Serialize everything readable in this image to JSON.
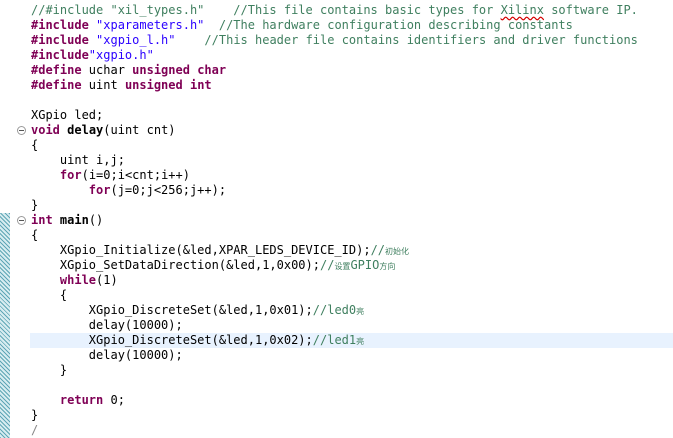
{
  "editor": {
    "lines": [
      [
        {
          "t": "//#include \"xil_types.h\"    //This file contains basic types for ",
          "c": "cm"
        },
        {
          "t": "Xilinx",
          "c": "cm sq"
        },
        {
          "t": " software IP.",
          "c": "cm"
        }
      ],
      [
        {
          "t": "#include",
          "c": "kw"
        },
        {
          "t": " "
        },
        {
          "t": "\"xparameters.h\"",
          "c": "str"
        },
        {
          "t": "  "
        },
        {
          "t": "//The hardware configuration describing constants",
          "c": "cm"
        }
      ],
      [
        {
          "t": "#include",
          "c": "kw"
        },
        {
          "t": " "
        },
        {
          "t": "\"xgpio_l.h\"",
          "c": "str"
        },
        {
          "t": "    "
        },
        {
          "t": "//This header file contains identifiers and driver functions",
          "c": "cm"
        }
      ],
      [
        {
          "t": "#include",
          "c": "kw"
        },
        {
          "t": "\"xgpio.h\"",
          "c": "str"
        }
      ],
      [
        {
          "t": "#define",
          "c": "kw"
        },
        {
          "t": " uchar "
        },
        {
          "t": "unsigned",
          "c": "kw"
        },
        {
          "t": " "
        },
        {
          "t": "char",
          "c": "kw"
        }
      ],
      [
        {
          "t": "#define",
          "c": "kw"
        },
        {
          "t": " uint "
        },
        {
          "t": "unsigned",
          "c": "kw"
        },
        {
          "t": " "
        },
        {
          "t": "int",
          "c": "kw"
        }
      ],
      [],
      [
        {
          "t": "XGpio led;"
        }
      ],
      [
        {
          "t": "void",
          "c": "kw"
        },
        {
          "t": " "
        },
        {
          "t": "delay",
          "c": "bd"
        },
        {
          "t": "(uint cnt)"
        }
      ],
      [
        {
          "t": "{"
        }
      ],
      [
        {
          "t": "    uint i,j;"
        }
      ],
      [
        {
          "t": "    "
        },
        {
          "t": "for",
          "c": "kw"
        },
        {
          "t": "(i=0;i<cnt;i++)"
        }
      ],
      [
        {
          "t": "        "
        },
        {
          "t": "for",
          "c": "kw"
        },
        {
          "t": "(j=0;j<256;j++);"
        }
      ],
      [
        {
          "t": "}"
        }
      ],
      [
        {
          "t": "int",
          "c": "kw"
        },
        {
          "t": " "
        },
        {
          "t": "main",
          "c": "bd"
        },
        {
          "t": "()"
        }
      ],
      [
        {
          "t": "{"
        }
      ],
      [
        {
          "t": "    XGpio_Initialize(&led,XPAR_LEDS_DEVICE_ID);"
        },
        {
          "t": "//",
          "c": "cm"
        },
        {
          "t": "初始化",
          "c": "cm cjk"
        }
      ],
      [
        {
          "t": "    XGpio_SetDataDirection(&led,1,0x00);"
        },
        {
          "t": "//",
          "c": "cm"
        },
        {
          "t": "设置",
          "c": "cm cjk"
        },
        {
          "t": "GPIO",
          "c": "cm"
        },
        {
          "t": "方向",
          "c": "cm cjk"
        }
      ],
      [
        {
          "t": "    "
        },
        {
          "t": "while",
          "c": "kw"
        },
        {
          "t": "(1)"
        }
      ],
      [
        {
          "t": "    {"
        }
      ],
      [
        {
          "t": "        XGpio_DiscreteSet(&led,1,0x01);"
        },
        {
          "t": "//led0",
          "c": "cm"
        },
        {
          "t": "亮",
          "c": "cm cjk"
        }
      ],
      [
        {
          "t": "        delay(10000);"
        }
      ],
      [
        {
          "t": "        XGpio_DiscreteSet(&led,1,0x02);"
        },
        {
          "t": "//led1",
          "c": "cm"
        },
        {
          "t": "亮",
          "c": "cm cjk"
        }
      ],
      [
        {
          "t": "        delay(10000);"
        }
      ],
      [
        {
          "t": "    }"
        }
      ],
      [],
      [
        {
          "t": "    "
        },
        {
          "t": "return",
          "c": "kw"
        },
        {
          "t": " 0;"
        }
      ],
      [
        {
          "t": "}"
        }
      ],
      [
        {
          "t": "/",
          "c": "partial"
        }
      ]
    ],
    "current_line": 22,
    "fold_lines": [
      8,
      14
    ],
    "change_ranges": [
      [
        14,
        29
      ]
    ]
  },
  "colors": {
    "comment": "#3f7f5f",
    "keyword": "#7f0055",
    "string": "#2a00ff",
    "current_line": "#e8f2fe"
  }
}
